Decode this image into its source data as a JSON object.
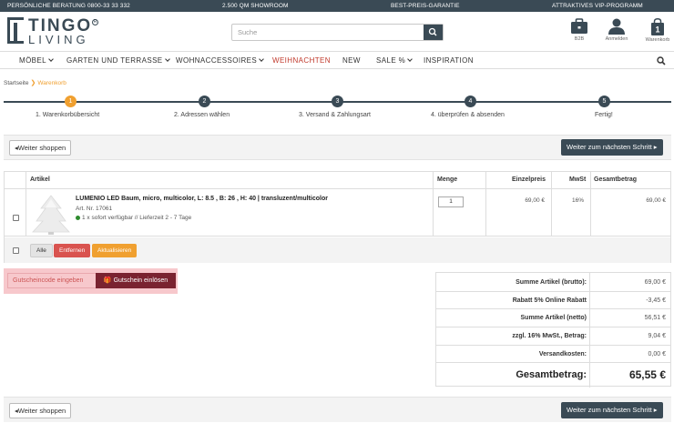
{
  "topbar": {
    "phone": "PERSÖNLICHE BERATUNG 0800-33 33 332",
    "showroom": "2.500 QM SHOWROOM",
    "price": "BEST-PREIS-GARANTIE",
    "vip": "ATTRAKTIVES VIP-PROGRAMM"
  },
  "logo": {
    "line1": "TINGO",
    "line2": "LIVING",
    "reg": "R"
  },
  "search": {
    "placeholder": "Suche"
  },
  "header_icons": {
    "b2b": "B2B",
    "login": "Anmelden",
    "cart_label": "Warenkorb",
    "cart_count": "1"
  },
  "nav": {
    "items": [
      "MÖBEL",
      "GARTEN UND TERRASSE",
      "WOHNACCESSOIRES",
      "WEIHNACHTEN",
      "NEW",
      "SALE %",
      "INSPIRATION"
    ]
  },
  "breadcrumb": {
    "home": "Startseite",
    "current": "Warenkorb"
  },
  "steps": [
    {
      "num": "1",
      "label": "1. Warenkorbübersicht"
    },
    {
      "num": "2",
      "label": "2. Adressen wählen"
    },
    {
      "num": "3",
      "label": "3. Versand & Zahlungsart"
    },
    {
      "num": "4",
      "label": "4. überprüfen & absenden"
    },
    {
      "num": "5",
      "label": "Fertig!"
    }
  ],
  "actions": {
    "continue_shopping": "Weiter shoppen",
    "next_step": "Weiter zum nächsten Schritt"
  },
  "cart": {
    "headers": {
      "article": "Artikel",
      "qty": "Menge",
      "unit_price": "Einzelpreis",
      "vat": "MwSt",
      "total": "Gesamtbetrag"
    },
    "item": {
      "title": "LUMENIO LED Baum, micro, multicolor, L: 8.5 , B: 26 , H: 40 | transluzent/multicolor",
      "art_nr": "Art. Nr. 17061",
      "availability": "1 x sofort verfügbar // Lieferzeit 2 - 7 Tage",
      "qty": "1",
      "unit_price": "69,00 €",
      "vat": "16%",
      "total": "69,00 €"
    },
    "buttons": {
      "all": "Alle",
      "remove": "Entfernen",
      "update": "Aktualisieren"
    }
  },
  "voucher": {
    "placeholder": "Gutscheincode eingeben",
    "redeem": "Gutschein einlösen"
  },
  "summary": {
    "rows": [
      {
        "label": "Summe Artikel (brutto):",
        "value": "69,00 €"
      },
      {
        "label": "Rabatt  5% Online Rabatt",
        "value": "-3,45 €"
      },
      {
        "label": "Summe Artikel (netto)",
        "value": "56,51 €"
      },
      {
        "label": "zzgl. 16% MwSt., Betrag:",
        "value": "9,04 €"
      },
      {
        "label": "Versandkosten:",
        "value": "0,00 €"
      }
    ],
    "total_label": "Gesamtbetrag:",
    "total_value": "65,55 €"
  }
}
